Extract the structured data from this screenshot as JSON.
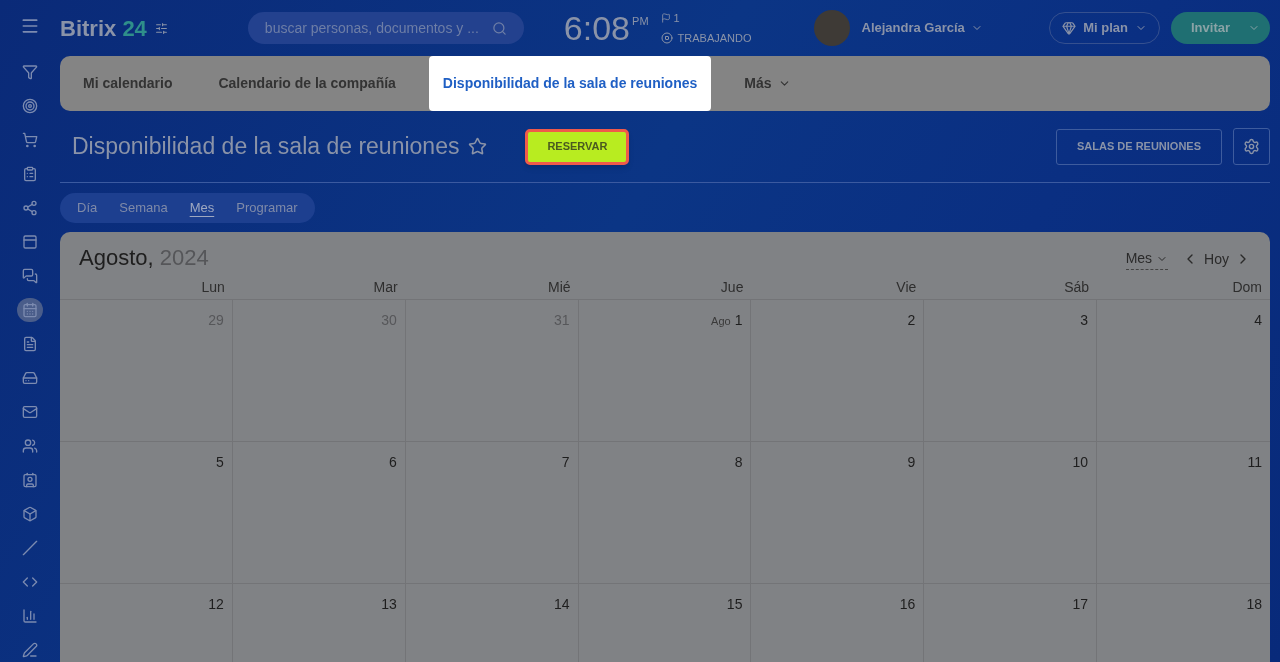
{
  "header": {
    "logo_word": "Bitrix",
    "logo_number": "24",
    "search": {
      "placeholder": "buscar personas, documentos y ..."
    },
    "clock": {
      "time": "6:08",
      "ampm": "PM",
      "flag_count": "1",
      "status": "TRABAJANDO"
    },
    "user": {
      "name": "Alejandra García"
    },
    "plan_button": "Mi plan",
    "invite_button": "Invitar"
  },
  "sidebar": {
    "items": [
      {
        "selected": false
      },
      {
        "selected": false
      },
      {
        "selected": false
      },
      {
        "selected": false
      },
      {
        "selected": false
      },
      {
        "selected": false
      },
      {
        "selected": false
      },
      {
        "selected": true
      },
      {
        "selected": false
      },
      {
        "selected": false
      },
      {
        "selected": false
      },
      {
        "selected": false
      },
      {
        "selected": false
      },
      {
        "selected": false
      },
      {
        "selected": false
      },
      {
        "selected": false
      },
      {
        "selected": false
      },
      {
        "selected": false
      }
    ]
  },
  "tabs": [
    {
      "label": "Mi calendario",
      "selected": false
    },
    {
      "label": "Calendario de la compañía",
      "selected": false
    },
    {
      "label": "Disponibilidad de la sala de reuniones",
      "selected": true
    },
    {
      "label": "Más",
      "selected": false
    }
  ],
  "page": {
    "title": "Disponibilidad de la sala de reuniones",
    "reserve_button": "RESERVAR",
    "rooms_button": "SALAS DE REUNIONES"
  },
  "view_switch": [
    {
      "label": "Día",
      "selected": false
    },
    {
      "label": "Semana",
      "selected": false
    },
    {
      "label": "Mes",
      "selected": true
    },
    {
      "label": "Programar",
      "selected": false
    }
  ],
  "calendar": {
    "month": "Agosto,",
    "year": "2024",
    "view_select": "Mes",
    "today_button": "Hoy",
    "weekdays": [
      "Lun",
      "Mar",
      "Mié",
      "Jue",
      "Vie",
      "Sáb",
      "Dom"
    ],
    "weeks": [
      [
        {
          "day": "29",
          "other_month": true
        },
        {
          "day": "30",
          "other_month": true
        },
        {
          "day": "31",
          "other_month": true
        },
        {
          "month_label": "Ago",
          "day": "1",
          "other_month": false
        },
        {
          "day": "2",
          "other_month": false
        },
        {
          "day": "3",
          "other_month": false
        },
        {
          "day": "4",
          "other_month": false
        }
      ],
      [
        {
          "day": "5",
          "other_month": false
        },
        {
          "day": "6",
          "other_month": false
        },
        {
          "day": "7",
          "other_month": false
        },
        {
          "day": "8",
          "other_month": false
        },
        {
          "day": "9",
          "other_month": false
        },
        {
          "day": "10",
          "other_month": false
        },
        {
          "day": "11",
          "other_month": false
        }
      ],
      [
        {
          "day": "12",
          "other_month": false
        },
        {
          "day": "13",
          "other_month": false
        },
        {
          "day": "14",
          "other_month": false
        },
        {
          "day": "15",
          "other_month": false
        },
        {
          "day": "16",
          "other_month": false
        },
        {
          "day": "17",
          "other_month": false
        },
        {
          "day": "18",
          "other_month": false
        }
      ]
    ]
  }
}
